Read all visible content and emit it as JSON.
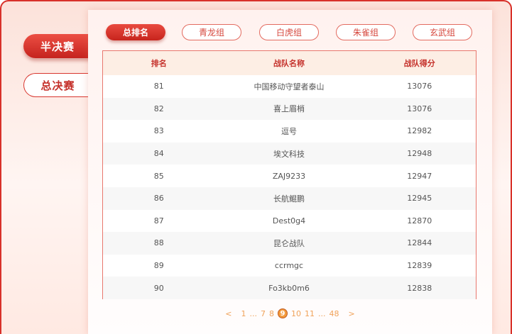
{
  "stages": {
    "semifinal": "半决赛",
    "final": "总决赛"
  },
  "tabs": [
    "总排名",
    "青龙组",
    "白虎组",
    "朱雀组",
    "玄武组"
  ],
  "table": {
    "headers": [
      "排名",
      "战队名称",
      "战队得分"
    ],
    "rows": [
      [
        "81",
        "中国移动守望者泰山",
        "13076"
      ],
      [
        "82",
        "喜上眉梢",
        "13076"
      ],
      [
        "83",
        "逗号",
        "12982"
      ],
      [
        "84",
        "埃文科技",
        "12948"
      ],
      [
        "85",
        "ZAJ9233",
        "12947"
      ],
      [
        "86",
        "长航鲲鹏",
        "12945"
      ],
      [
        "87",
        "Dest0g4",
        "12870"
      ],
      [
        "88",
        "昆仑战队",
        "12844"
      ],
      [
        "89",
        "ccrmgc",
        "12839"
      ],
      [
        "90",
        "Fo3kb0m6",
        "12838"
      ]
    ]
  },
  "pagination": {
    "prev": "<",
    "pages": [
      "1",
      "...",
      "7",
      "8",
      "9",
      "10",
      "11",
      "...",
      "48"
    ],
    "current": "9",
    "next": ">"
  },
  "colors": {
    "accent": "#d8312a",
    "pager": "#f39a3c",
    "header_bg": "#fdeee4"
  }
}
